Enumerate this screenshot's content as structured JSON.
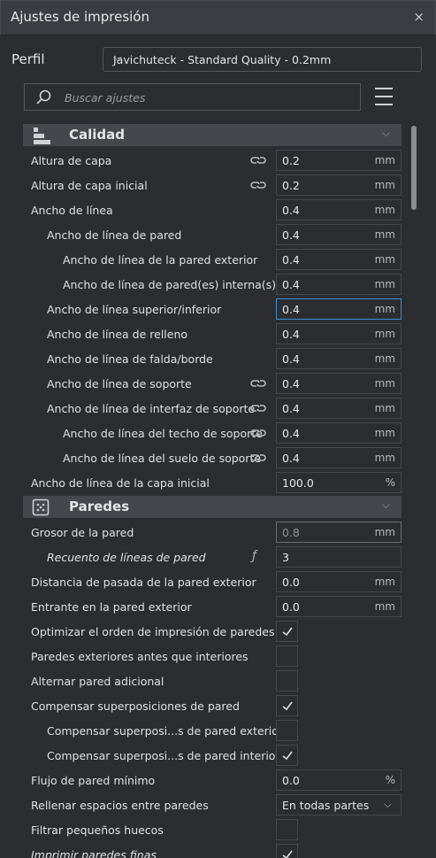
{
  "window": {
    "title": "Ajustes de impresión",
    "close_glyph": "×"
  },
  "profile": {
    "label": "Perfil",
    "value": "Javichuteck - Standard Quality - 0.2mm"
  },
  "search": {
    "placeholder": "Buscar ajustes",
    "icon": "search-icon",
    "menu_icon": "hamburger-menu-icon"
  },
  "categories": [
    {
      "label": "Calidad",
      "icon": "quality-icon"
    },
    {
      "label": "Paredes",
      "icon": "walls-icon"
    }
  ],
  "calidad_rows": [
    {
      "label": "Altura de capa",
      "value": "0.2",
      "unit": "mm",
      "linked": true
    },
    {
      "label": "Altura de capa inicial",
      "value": "0.2",
      "unit": "mm",
      "linked": true
    },
    {
      "label": "Ancho de línea",
      "value": "0.4",
      "unit": "mm"
    },
    {
      "label": "Ancho de línea de pared",
      "value": "0.4",
      "unit": "mm"
    },
    {
      "label": "Ancho de línea de la pared exterior",
      "value": "0.4",
      "unit": "mm"
    },
    {
      "label": "Ancho de línea de pared(es) interna(s)",
      "value": "0.4",
      "unit": "mm"
    },
    {
      "label": "Ancho de línea superior/inferior",
      "value": "0.4",
      "unit": "mm",
      "active": true
    },
    {
      "label": "Ancho de línea de relleno",
      "value": "0.4",
      "unit": "mm"
    },
    {
      "label": "Ancho de línea de falda/borde",
      "value": "0.4",
      "unit": "mm"
    },
    {
      "label": "Ancho de línea de soporte",
      "value": "0.4",
      "unit": "mm",
      "linked": true
    },
    {
      "label": "Ancho de línea de interfaz de soporte",
      "value": "0.4",
      "unit": "mm",
      "linked": true
    },
    {
      "label": "Ancho de línea del techo de soporte",
      "value": "0.4",
      "unit": "mm",
      "linked": true
    },
    {
      "label": "Ancho de línea del suelo de soporte",
      "value": "0.4",
      "unit": "mm",
      "linked": true
    },
    {
      "label": "Ancho de línea de la capa inicial",
      "value": "100.0",
      "unit": "%"
    }
  ],
  "paredes_rows": [
    {
      "label": "Grosor de la pared",
      "value": "0.8",
      "unit": "mm",
      "dim": true
    },
    {
      "label": "Recuento de líneas de pared",
      "value": "3",
      "unit": "",
      "function": "ƒ",
      "italic": true
    },
    {
      "label": "Distancia de pasada de la pared exterior",
      "value": "0.0",
      "unit": "mm"
    },
    {
      "label": "Entrante en la pared exterior",
      "value": "0.0",
      "unit": "mm"
    },
    {
      "label": "Optimizar el orden de impresión de paredes",
      "checkbox": true,
      "checked": true
    },
    {
      "label": "Paredes exteriores antes que interiores",
      "checkbox": true,
      "checked": false
    },
    {
      "label": "Alternar pared adicional",
      "checkbox": true,
      "checked": false
    },
    {
      "label": "Compensar superposiciones de pared",
      "checkbox": true,
      "checked": true
    },
    {
      "label": "Compensar superposi...s de pared exterior",
      "checkbox": true,
      "checked": false
    },
    {
      "label": "Compensar superposi...s de pared interior",
      "checkbox": true,
      "checked": true
    },
    {
      "label": "Flujo de pared mínimo",
      "value": "0.0",
      "unit": "%"
    },
    {
      "label": "Rellenar espacios entre paredes",
      "dropdown": true,
      "value": "En todas partes"
    },
    {
      "label": "Filtrar pequeños huecos",
      "checkbox": true,
      "checked": false
    },
    {
      "label": "Imprimir paredes finas",
      "checkbox": true,
      "checked": true,
      "italic": true
    }
  ]
}
